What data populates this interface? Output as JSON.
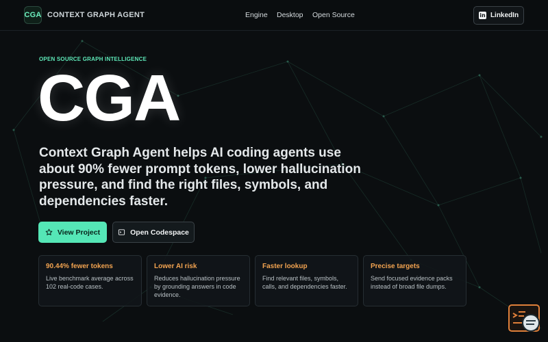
{
  "header": {
    "logo_text": "CGA",
    "brand_name": "CONTEXT GRAPH AGENT",
    "nav": [
      "Engine",
      "Desktop",
      "Open Source"
    ],
    "linkedin_label": "LinkedIn"
  },
  "hero": {
    "eyebrow": "OPEN SOURCE GRAPH INTELLIGENCE",
    "title": "CGA",
    "description": "Context Graph Agent helps AI coding agents use about 90% fewer prompt tokens, lower hallucination pressure, and find the right files, symbols, and dependencies faster."
  },
  "actions": {
    "view_project": "View Project",
    "open_codespace": "Open Codespace"
  },
  "features": [
    {
      "title": "90.44% fewer tokens",
      "text": "Live benchmark average across 102 real-code cases."
    },
    {
      "title": "Lower AI risk",
      "text": "Reduces hallucination pressure by grounding answers in code evidence."
    },
    {
      "title": "Faster lookup",
      "text": "Find relevant files, symbols, calls, and dependencies faster."
    },
    {
      "title": "Precise targets",
      "text": "Send focused evidence packs instead of broad file dumps."
    }
  ],
  "colors": {
    "background": "#0b0e10",
    "accent": "#55e6b6",
    "feature_title": "#f2a350"
  },
  "icons": {
    "view_project": "star-icon",
    "open_codespace": "terminal-icon",
    "linkedin": "linkedin-icon",
    "widget": "chat-terminal-icon"
  }
}
